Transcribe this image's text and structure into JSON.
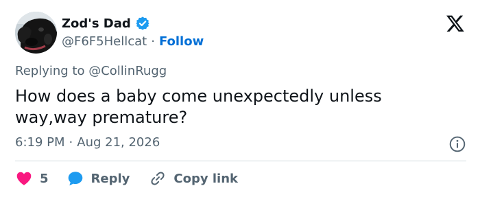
{
  "author": {
    "display_name": "Zod's Dad",
    "handle": "@F6F5Hellcat",
    "separator": "·",
    "follow_label": "Follow"
  },
  "reply_context": {
    "prefix": "Replying to",
    "mention": "@CollinRugg"
  },
  "tweet": {
    "text": "How does a baby come unexpectedly unless way,way premature?"
  },
  "meta": {
    "time": "6:19 PM",
    "separator": "·",
    "date": "Aug 21, 2026"
  },
  "actions": {
    "like_count": "5",
    "reply_label": "Reply",
    "copy_link_label": "Copy link"
  },
  "icons": {
    "logo": "x-logo-icon",
    "verified": "verified-badge-icon",
    "info": "info-icon",
    "like": "heart-icon",
    "reply": "speech-bubble-icon",
    "copy_link": "link-icon"
  },
  "colors": {
    "text": "#0f1419",
    "muted": "#536471",
    "link": "#006fd6",
    "verified": "#1d9bf0",
    "like": "#f91880",
    "reply": "#1d9bf0",
    "divider": "#cfd9de"
  }
}
